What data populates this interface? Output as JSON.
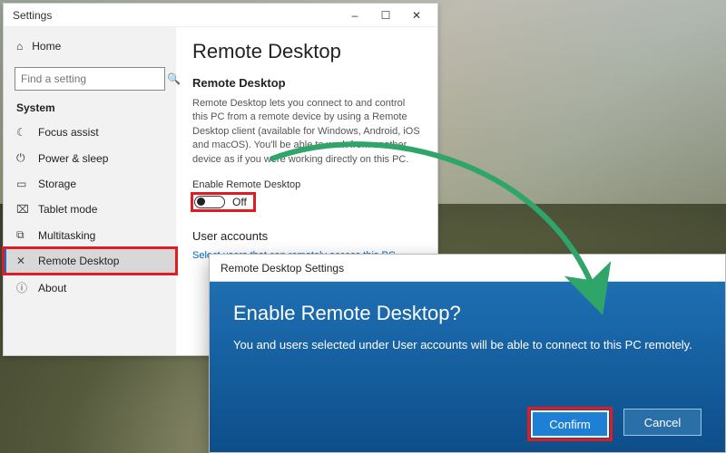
{
  "window": {
    "title": "Settings",
    "min_label": "–",
    "max_label": "☐",
    "close_label": "✕"
  },
  "sidebar": {
    "home_label": "Home",
    "search_placeholder": "Find a setting",
    "section_label": "System",
    "items": [
      {
        "icon": "☾",
        "label": "Focus assist"
      },
      {
        "icon": "⏻",
        "label": "Power & sleep"
      },
      {
        "icon": "▭",
        "label": "Storage"
      },
      {
        "icon": "⌧",
        "label": "Tablet mode"
      },
      {
        "icon": "⧉",
        "label": "Multitasking"
      },
      {
        "icon": "✕",
        "label": "Remote Desktop"
      },
      {
        "icon": "ⓘ",
        "label": "About"
      }
    ]
  },
  "content": {
    "page_title": "Remote Desktop",
    "section_title": "Remote Desktop",
    "description": "Remote Desktop lets you connect to and control this PC from a remote device by using a Remote Desktop client (available for Windows, Android, iOS and macOS). You'll be able to work from another device as if you were working directly on this PC.",
    "toggle_label": "Enable Remote Desktop",
    "toggle_state": "Off",
    "user_accounts_heading": "User accounts",
    "select_users_link": "Select users that can remotely access this PC"
  },
  "dialog": {
    "title": "Remote Desktop Settings",
    "heading": "Enable Remote Desktop?",
    "body": "You and users selected under User accounts will be able to connect to this PC remotely.",
    "confirm_label": "Confirm",
    "cancel_label": "Cancel"
  },
  "annotations": {
    "highlighted_sidebar_item_index": 5,
    "highlighted_toggle": true,
    "highlighted_confirm_button": true,
    "arrow_from": "toggle",
    "arrow_to": "confirm-button",
    "arrow_color": "#2fa56a"
  }
}
